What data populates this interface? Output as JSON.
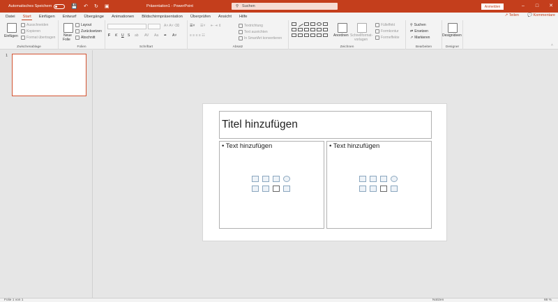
{
  "titlebar": {
    "autosave_label": "Automatisches Speichern",
    "doc_title": "Präsentation1 - PowerPoint",
    "search_placeholder": "Suchen",
    "signin_label": "Anmelden",
    "window_controls": [
      "minimize-icon",
      "restore-icon",
      "close-icon"
    ]
  },
  "menubar": {
    "tabs": [
      "Datei",
      "Start",
      "Einfügen",
      "Entwurf",
      "Übergänge",
      "Animationen",
      "Bildschirmpräsentation",
      "Überprüfen",
      "Ansicht",
      "Hilfe"
    ],
    "active_tab": "Start",
    "share_label": "Teilen",
    "comments_label": "Kommentare"
  },
  "ribbon": {
    "clipboard": {
      "paste": "Einfügen",
      "cut": "Ausschneiden",
      "copy": "Kopieren",
      "format": "Format übertragen",
      "label": "Zwischenablage"
    },
    "slides": {
      "new_slide_1": "Neue",
      "new_slide_2": "Folie",
      "layout": "Layout",
      "reset": "Zurücksetzen",
      "section": "Abschnitt",
      "label": "Folien"
    },
    "font": {
      "label": "Schriftart",
      "bold": "F",
      "italic": "K",
      "underline": "U",
      "strike": "S",
      "shadow": "ab"
    },
    "paragraph": {
      "text_direction": "Textrichtung",
      "align_text": "Text ausrichten",
      "smartart": "In SmartArt konvertieren",
      "label": "Absatz"
    },
    "drawing": {
      "arrange": "Anordnen",
      "quick_styles_1": "Schnellformat-",
      "quick_styles_2": "vorlagen",
      "fill": "Fülleffekt",
      "outline": "Formkontur",
      "effects": "Formeffekte",
      "label": "Zeichnen"
    },
    "editing": {
      "find": "Suchen",
      "replace": "Ersetzen",
      "select": "Markieren",
      "label": "Bearbeiten"
    },
    "designer": {
      "ideas": "Designideen",
      "label": "Designer"
    }
  },
  "thumbnails": [
    {
      "number": "1"
    }
  ],
  "slide": {
    "title_placeholder": "Titel hinzufügen",
    "left_text_placeholder": "Text hinzufügen",
    "right_text_placeholder": "Text hinzufügen",
    "insert_icons": [
      "table-icon",
      "chart-icon",
      "smartart-icon",
      "3d-model-icon",
      "picture-icon",
      "online-picture-icon",
      "video-icon",
      "icons-icon"
    ]
  },
  "statusbar": {
    "slide_info": "Folie 1 von 1",
    "notes_label": "Notizen",
    "zoom": "66 %"
  }
}
